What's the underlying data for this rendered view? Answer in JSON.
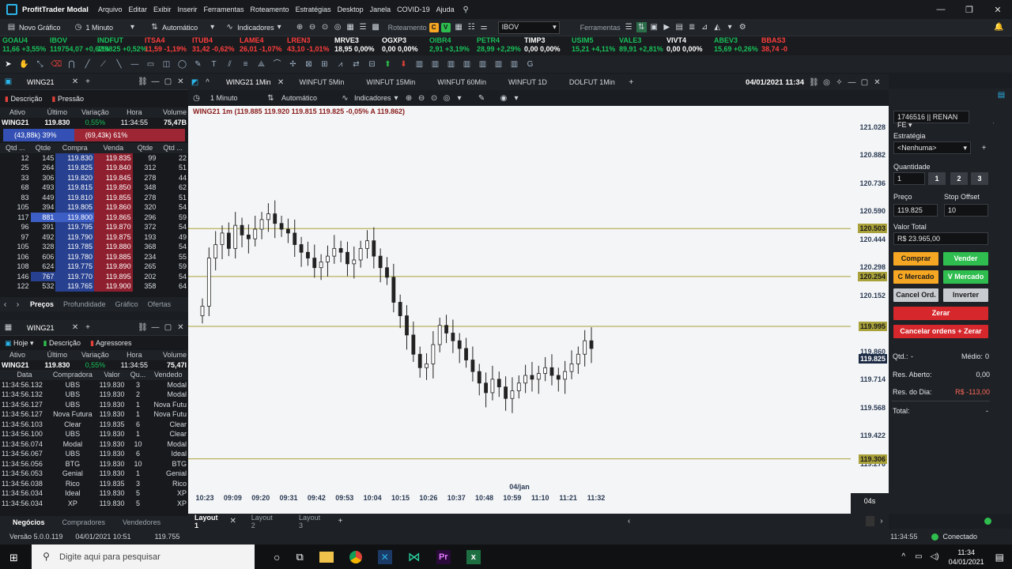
{
  "window": {
    "title": "ProfitTrader Modal",
    "menu": [
      "Arquivo",
      "Editar",
      "Exibir",
      "Inserir",
      "Ferramentas",
      "Roteamento",
      "Estratégias",
      "Desktop",
      "Janela",
      "COVID-19",
      "Ajuda"
    ]
  },
  "toolbar": {
    "new_chart": "Novo Gráfico",
    "timeframe": "1 Minuto",
    "mode": "Automático",
    "indicators": "Indicadores",
    "routing": "Roteamento",
    "symbol": "IBOV",
    "tools": "Ferramentas",
    "routing_badges": [
      "C",
      "V"
    ]
  },
  "ticker": [
    {
      "sym": "GOAU4",
      "val": "11,66 +3,55%",
      "dir": "up"
    },
    {
      "sym": "IBOV",
      "val": "119754,07 +0,62%",
      "dir": "up"
    },
    {
      "sym": "INDFUT",
      "val": "119825 +0,52%",
      "dir": "up"
    },
    {
      "sym": "ITSA4",
      "val": "11,59 -1,19%",
      "dir": "dn"
    },
    {
      "sym": "ITUB4",
      "val": "31,42 -0,62%",
      "dir": "dn"
    },
    {
      "sym": "LAME4",
      "val": "26,01 -1,07%",
      "dir": "dn"
    },
    {
      "sym": "LREN3",
      "val": "43,10 -1,01%",
      "dir": "dn"
    },
    {
      "sym": "MRVE3",
      "val": "18,95 0,00%",
      "dir": "fl"
    },
    {
      "sym": "OGXP3",
      "val": "0,00 0,00%",
      "dir": "fl"
    },
    {
      "sym": "OIBR4",
      "val": "2,91 +3,19%",
      "dir": "up"
    },
    {
      "sym": "PETR4",
      "val": "28,99 +2,29%",
      "dir": "up"
    },
    {
      "sym": "TIMP3",
      "val": "0,00 0,00%",
      "dir": "fl"
    },
    {
      "sym": "USIM5",
      "val": "15,21 +4,11%",
      "dir": "up"
    },
    {
      "sym": "VALE3",
      "val": "89,91 +2,81%",
      "dir": "up"
    },
    {
      "sym": "VIVT4",
      "val": "0,00 0,00%",
      "dir": "fl"
    },
    {
      "sym": "ABEV3",
      "val": "15,69 +0,26%",
      "dir": "up"
    },
    {
      "sym": "BBAS3",
      "val": "38,74 -0",
      "dir": "dn"
    }
  ],
  "book": {
    "tab": "WING21",
    "subtabs": [
      "Descrição",
      "Pressão"
    ],
    "headers": [
      "Ativo",
      "Último",
      "Variação",
      "Hora",
      "Volume"
    ],
    "summary": {
      "asset": "WING21",
      "last": "119.830",
      "var": "0,55%",
      "time": "11:34:55",
      "volume": "75,47B"
    },
    "pressure": {
      "buy": "(43,88k) 39%",
      "sell": "(69,43k) 61%",
      "buy_frac": 0.39
    },
    "cols": [
      "Qtd ...",
      "Qtde",
      "Compra",
      "Venda",
      "Qtde",
      "Qtd ..."
    ],
    "rows": [
      [
        "12",
        "145",
        "119.830",
        "119.835",
        "99",
        "22"
      ],
      [
        "25",
        "264",
        "119.825",
        "119.840",
        "312",
        "51"
      ],
      [
        "33",
        "306",
        "119.820",
        "119.845",
        "278",
        "44"
      ],
      [
        "68",
        "493",
        "119.815",
        "119.850",
        "348",
        "62"
      ],
      [
        "83",
        "449",
        "119.810",
        "119.855",
        "278",
        "51"
      ],
      [
        "105",
        "394",
        "119.805",
        "119.860",
        "320",
        "54"
      ],
      [
        "117",
        "881",
        "119.800",
        "119.865",
        "296",
        "59"
      ],
      [
        "96",
        "391",
        "119.795",
        "119.870",
        "372",
        "54"
      ],
      [
        "97",
        "492",
        "119.790",
        "119.875",
        "193",
        "49"
      ],
      [
        "105",
        "328",
        "119.785",
        "119.880",
        "368",
        "54"
      ],
      [
        "106",
        "606",
        "119.780",
        "119.885",
        "234",
        "55"
      ],
      [
        "108",
        "624",
        "119.775",
        "119.890",
        "265",
        "59"
      ],
      [
        "146",
        "767",
        "119.770",
        "119.895",
        "202",
        "54"
      ],
      [
        "122",
        "532",
        "119.765",
        "119.900",
        "358",
        "64"
      ]
    ],
    "bottom_tabs": [
      "Preços",
      "Profundidade",
      "Gráfico",
      "Ofertas"
    ]
  },
  "trades": {
    "tab": "WING21",
    "subtabs": [
      "Hoje",
      "Descrição",
      "Agressores"
    ],
    "headers": [
      "Ativo",
      "Último",
      "Variação",
      "Hora",
      "Volume"
    ],
    "summary": {
      "asset": "WING21",
      "last": "119.830",
      "var": "0,55%",
      "time": "11:34:55",
      "volume": "75,47I"
    },
    "cols": [
      "Data",
      "Compradora",
      "Valor",
      "Qu...",
      "Vendedo"
    ],
    "rows": [
      [
        "11:34:56.132",
        "UBS",
        "119.830",
        "3",
        "Modal"
      ],
      [
        "11:34:56.132",
        "UBS",
        "119.830",
        "2",
        "Modal"
      ],
      [
        "11:34:56.127",
        "UBS",
        "119.830",
        "1",
        "Nova Futu"
      ],
      [
        "11:34:56.127",
        "Nova Futura",
        "119.830",
        "1",
        "Nova Futu"
      ],
      [
        "11:34:56.103",
        "Clear",
        "119.835",
        "6",
        "Clear"
      ],
      [
        "11:34:56.100",
        "UBS",
        "119.830",
        "1",
        "Clear"
      ],
      [
        "11:34:56.074",
        "Modal",
        "119.830",
        "10",
        "Modal"
      ],
      [
        "11:34:56.067",
        "UBS",
        "119.830",
        "6",
        "Ideal"
      ],
      [
        "11:34:56.056",
        "BTG",
        "119.830",
        "10",
        "BTG"
      ],
      [
        "11:34:56.053",
        "Genial",
        "119.830",
        "1",
        "Genial"
      ],
      [
        "11:34:56.038",
        "Rico",
        "119.835",
        "3",
        "Rico"
      ],
      [
        "11:34:56.034",
        "Ideal",
        "119.830",
        "5",
        "XP"
      ],
      [
        "11:34:56.034",
        "XP",
        "119.830",
        "5",
        "XP"
      ]
    ],
    "bottom_tabs": [
      "Negócios",
      "Compradores",
      "Vendedores"
    ]
  },
  "chart": {
    "tabs": [
      "WING21 1Min",
      "WINFUT 5Min",
      "WINFUT 15Min",
      "WINFUT 60Min",
      "WINFUT 1D",
      "DOLFUT 1Min"
    ],
    "datetime": "04/01/2021 11:34",
    "timeframe": "1 Minuto",
    "mode": "Automático",
    "indicators": "Indicadores",
    "legend": "WING21 1m (119.885  119.920  119.815  119.825  -0,05%  A 119.862)",
    "countdown": "04s",
    "date_label": "04/jan",
    "layouts": [
      "Layout 1",
      "Layout 2",
      "Layout 3"
    ]
  },
  "chart_data": {
    "type": "candlestick",
    "x_ticks": [
      "10:23",
      "09:09",
      "09:20",
      "09:31",
      "09:42",
      "09:53",
      "10:04",
      "10:15",
      "10:26",
      "10:37",
      "10:48",
      "10:59",
      "11:10",
      "11:21",
      "11:32"
    ],
    "y_ticks": [
      121.028,
      120.882,
      120.736,
      120.59,
      120.444,
      120.298,
      120.152,
      119.86,
      119.714,
      119.568,
      119.422,
      119.276
    ],
    "ylim": [
      119.21,
      121.1
    ],
    "levels": [
      {
        "value": "120.503",
        "color": "#a9a13a"
      },
      {
        "value": "120.254",
        "color": "#a9a13a"
      },
      {
        "value": "119.995",
        "color": "#a9a13a"
      },
      {
        "value": "119.306",
        "color": "#a9a13a"
      }
    ],
    "current_price": "119.825",
    "close_series": [
      120.1,
      120.35,
      120.42,
      120.48,
      120.4,
      120.52,
      120.47,
      120.45,
      120.5,
      120.55,
      120.58,
      120.53,
      120.5,
      120.48,
      120.42,
      120.38,
      120.35,
      120.3,
      120.33,
      120.36,
      120.4,
      120.38,
      120.32,
      120.34,
      120.4,
      120.44,
      120.36,
      120.3,
      120.25,
      120.12,
      120.05,
      119.95,
      119.85,
      119.78,
      119.8,
      119.9,
      120.0,
      119.96,
      119.92,
      119.88,
      119.82,
      119.76,
      119.7,
      119.65,
      119.72,
      119.68,
      119.62,
      119.66,
      119.7,
      119.74,
      119.72,
      119.75,
      119.78,
      119.74,
      119.72,
      119.76,
      119.8,
      119.85,
      119.92,
      119.88
    ]
  },
  "boleta": {
    "account": "1746516 || RENAN FE",
    "strategy_label": "Estratégia",
    "strategy": "<Nenhuma>",
    "qty_label": "Quantidade",
    "qty": "1",
    "qty_presets": [
      "1",
      "2",
      "3"
    ],
    "price_label": "Preço",
    "price": "119.825",
    "stop_label": "Stop Offset",
    "stop": "10",
    "total_label": "Valor Total",
    "total": "R$ 23.965,00",
    "buttons": [
      "Comprar",
      "Vender",
      "C Mercado",
      "V Mercado",
      "Cancel Ord.",
      "Inverter",
      "Zerar",
      "Cancelar ordens + Zerar"
    ],
    "qtd_label": "Qtd.:",
    "qtd_val": "-",
    "medio_label": "Médio:",
    "medio_val": "0",
    "res_aberto_label": "Res. Aberto:",
    "res_aberto": "0,00",
    "res_dia_label": "Res. do Dia:",
    "res_dia": "R$ -113,00",
    "total2_label": "Total:",
    "total2": "-"
  },
  "status": {
    "version": "Versão 5.0.0.119",
    "date": "04/01/2021 10:51",
    "ibov": "119.755",
    "clock": "11:34:55",
    "conn": "Conectado"
  },
  "taskbar": {
    "search": "Digite aqui para pesquisar",
    "time": "11:34",
    "date": "04/01/2021"
  }
}
